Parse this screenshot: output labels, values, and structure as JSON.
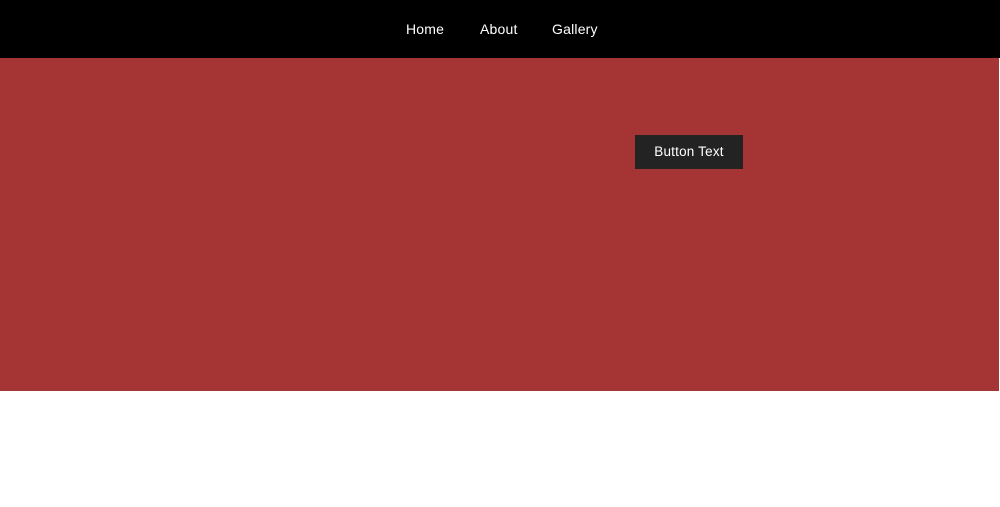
{
  "nav": {
    "items": [
      {
        "label": "Home"
      },
      {
        "label": "About"
      },
      {
        "label": "Gallery"
      }
    ]
  },
  "hero": {
    "button_label": "Button Text"
  },
  "colors": {
    "nav_background": "#000000",
    "hero_background": "#a53434",
    "button_background": "#232323",
    "text_light": "#ffffff",
    "page_background": "#ffffff"
  }
}
